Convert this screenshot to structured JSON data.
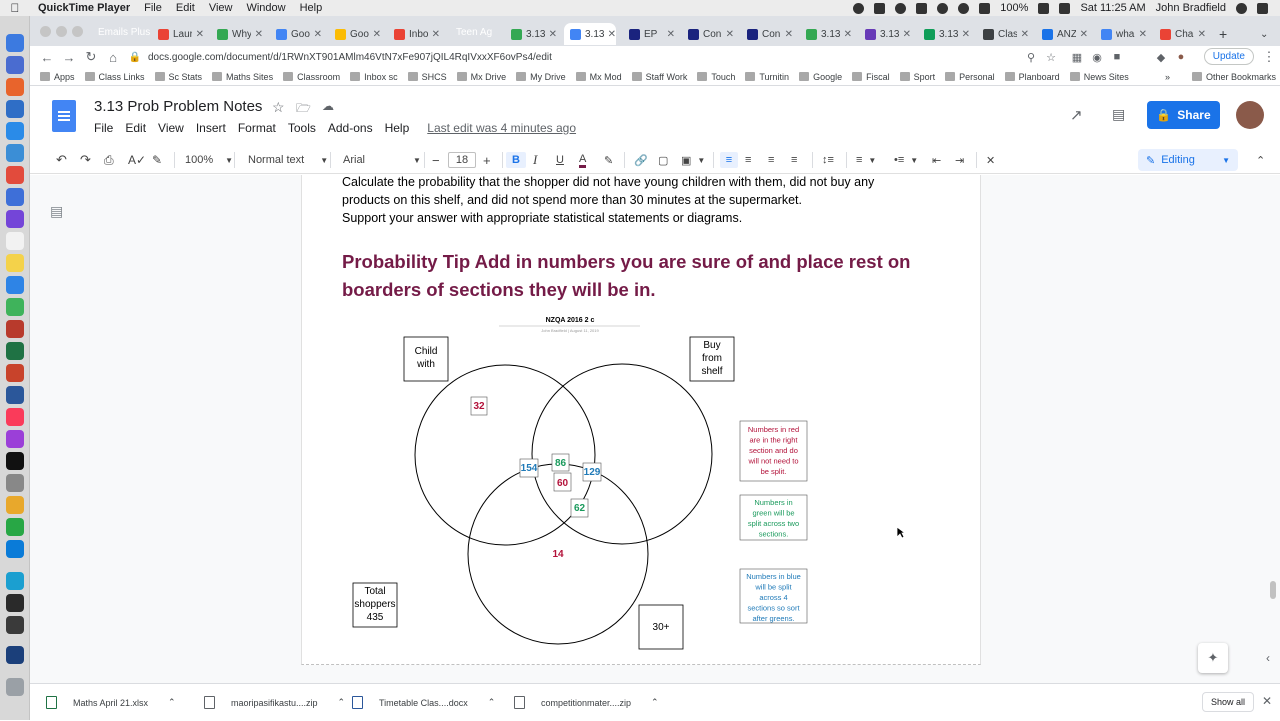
{
  "mac_menubar": {
    "app": "QuickTime Player",
    "menus": [
      "File",
      "Edit",
      "View",
      "Window",
      "Help"
    ],
    "battery": "100%",
    "clock": "Sat 11:25 AM",
    "user": "John Bradfield"
  },
  "browser": {
    "chips": [
      {
        "label": "Emails Plus",
        "color": "#d93025"
      },
      {
        "label": "Teen Ag",
        "color": "#1e8e3e"
      }
    ],
    "tabs": [
      {
        "label": "Laur",
        "color": "#ea4335"
      },
      {
        "label": "Why",
        "color": "#34a853"
      },
      {
        "label": "Goo",
        "color": "#4285f4"
      },
      {
        "label": "Goo",
        "color": "#fbbc04"
      },
      {
        "label": "Inbo",
        "color": "#ea4335"
      },
      {
        "label": "3.13",
        "color": "#34a853"
      },
      {
        "label": "3.13",
        "color": "#4285f4",
        "active": true
      },
      {
        "label": "EP",
        "color": "#1a237e"
      },
      {
        "label": "Con",
        "color": "#1a237e"
      },
      {
        "label": "Con",
        "color": "#1a237e"
      },
      {
        "label": "3.13",
        "color": "#34a853"
      },
      {
        "label": "3.13",
        "color": "#673ab7"
      },
      {
        "label": "3.13",
        "color": "#0f9d58"
      },
      {
        "label": "Clas",
        "color": "#3c4043"
      },
      {
        "label": "ANZ",
        "color": "#1a73e8"
      },
      {
        "label": "wha",
        "color": "#4285f4"
      },
      {
        "label": "Cha",
        "color": "#ea4335"
      }
    ],
    "url": "docs.google.com/document/d/1RWnXT901AMlm46VtN7xFe907jQIL4RqIVxxXF6ovPs4/edit",
    "update_label": "Update",
    "bookmarks": [
      "Apps",
      "Class Links",
      "Sc Stats",
      "Maths Sites",
      "Classroom",
      "Inbox sc",
      "SHCS",
      "Mx Drive",
      "My Drive",
      "Mx Mod",
      "Staff Work",
      "Touch",
      "Turnitin",
      "Google",
      "Fiscal",
      "Sport",
      "Personal",
      "Planboard",
      "News Sites"
    ],
    "other_bookmarks": "Other Bookmarks"
  },
  "docs": {
    "title": "3.13 Prob Problem Notes",
    "menus": [
      "File",
      "Edit",
      "View",
      "Insert",
      "Format",
      "Tools",
      "Add-ons",
      "Help"
    ],
    "last_edit": "Last edit was 4 minutes ago",
    "share_label": "Share",
    "toolbar": {
      "zoom": "100%",
      "style": "Normal text",
      "font": "Arial",
      "font_size": "18",
      "mode": "Editing"
    },
    "body": {
      "line1": "Calculate the probability that the shopper did not have young children with them, did not buy any",
      "line2": "products on this shelf, and did not spend more than 30 minutes at the supermarket.",
      "line3": "Support your answer with appropriate statistical statements or diagrams.",
      "tip": "Probability Tip Add in numbers you are sure of and place rest on boarders of sections they will be in."
    },
    "diagram": {
      "title": "NZQA 2016 2 c",
      "subtitle": "John Bradfield | August 11, 2019",
      "label_child": [
        "Child",
        "with"
      ],
      "label_buy": [
        "Buy",
        "from",
        "shelf"
      ],
      "label_total": [
        "Total",
        "shoppers",
        "435"
      ],
      "label_30": "30+",
      "numbers": {
        "n32": "32",
        "n154": "154",
        "n86": "86",
        "n129": "129",
        "n60": "60",
        "n62": "62",
        "n14": "14"
      },
      "note_red": [
        "Numbers in red",
        "are in the right",
        "section and do",
        "will not need to",
        "be split."
      ],
      "note_green": [
        "Numbers in",
        "green will be",
        "split across two",
        "sections."
      ],
      "note_blue": [
        "Numbers in blue",
        "will be split",
        "across 4",
        "sections so sort",
        "after greens."
      ],
      "colors": {
        "red": "#b3123a",
        "green": "#1a9a5c",
        "blue": "#1f7ab8"
      }
    }
  },
  "downloads": {
    "items": [
      "Maths April 21.xlsx",
      "maoripasifikastu....zip",
      "Timetable Clas....docx",
      "competitionmater....zip"
    ],
    "show_all": "Show all"
  }
}
